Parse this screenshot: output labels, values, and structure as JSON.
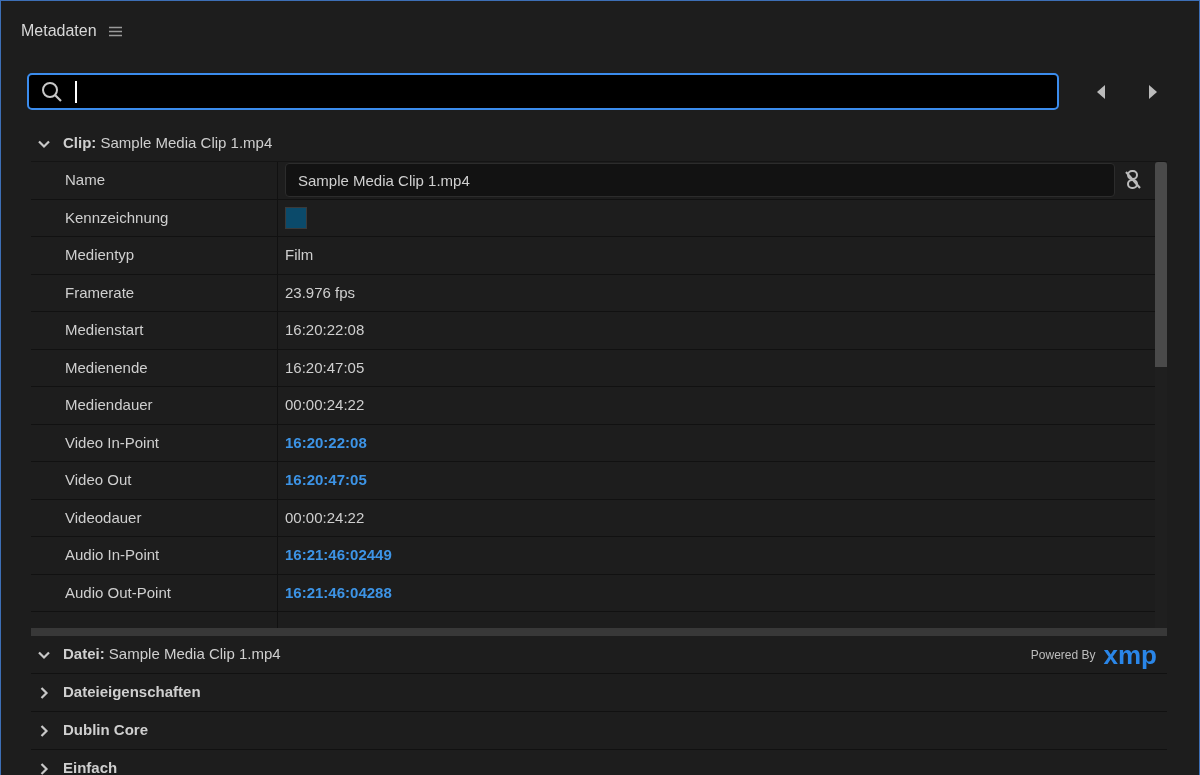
{
  "panel": {
    "title": "Metadaten"
  },
  "clip_section": {
    "label": "Clip:",
    "name": "Sample Media Clip 1.mp4",
    "expanded": true,
    "rows": [
      {
        "label": "Name",
        "kind": "field",
        "value": "Sample Media Clip 1.mp4"
      },
      {
        "label": "Kennzeichnung",
        "kind": "swatch",
        "color": "#0b4a6a"
      },
      {
        "label": "Medientyp",
        "kind": "text",
        "value": "Film"
      },
      {
        "label": "Framerate",
        "kind": "text",
        "value": "23.976 fps"
      },
      {
        "label": "Medienstart",
        "kind": "text",
        "value": "16:20:22:08"
      },
      {
        "label": "Medienende",
        "kind": "text",
        "value": "16:20:47:05"
      },
      {
        "label": "Mediendauer",
        "kind": "text",
        "value": "00:00:24:22"
      },
      {
        "label": "Video In-Point",
        "kind": "link",
        "value": "16:20:22:08"
      },
      {
        "label": "Video Out",
        "kind": "link",
        "value": "16:20:47:05"
      },
      {
        "label": "Videodauer",
        "kind": "text",
        "value": "00:00:24:22"
      },
      {
        "label": "Audio In-Point",
        "kind": "link",
        "value": "16:21:46:02449"
      },
      {
        "label": "Audio Out-Point",
        "kind": "link",
        "value": "16:21:46:04288"
      }
    ]
  },
  "file_section": {
    "label": "Datei:",
    "name": "Sample Media Clip 1.mp4",
    "expanded": true,
    "powered_by": "Powered By",
    "logo": "xmp"
  },
  "groups": [
    {
      "label": "Dateieigenschaften",
      "expanded": false
    },
    {
      "label": "Dublin Core",
      "expanded": false
    },
    {
      "label": "Einfach",
      "expanded": false
    }
  ]
}
